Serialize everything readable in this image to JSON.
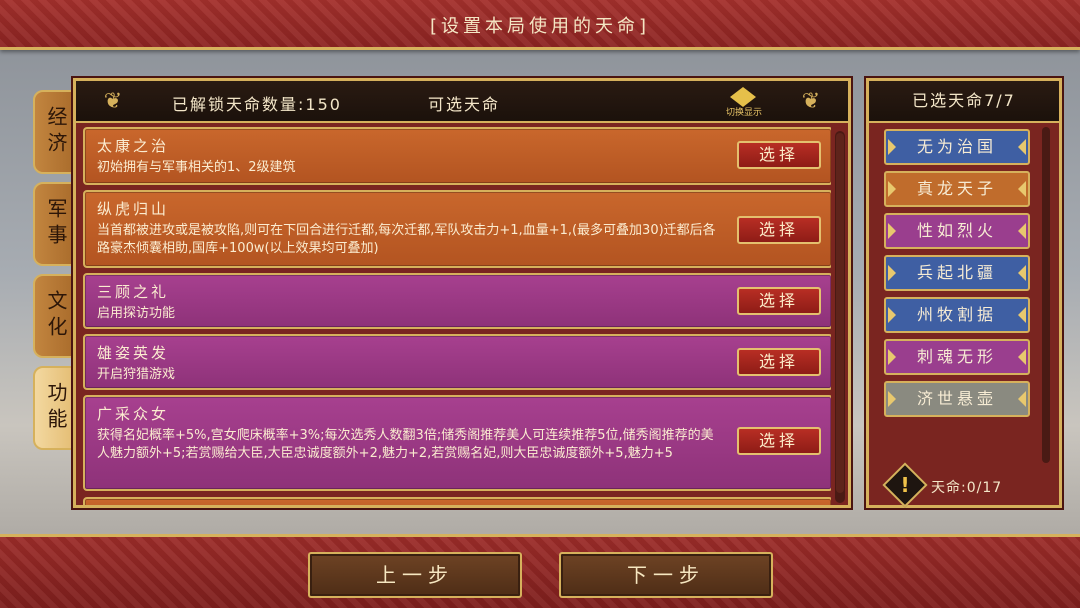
{
  "header": {
    "title": "[设置本局使用的天命]"
  },
  "tabs": [
    {
      "label": "经济",
      "active": false
    },
    {
      "label": "军事",
      "active": false
    },
    {
      "label": "文化",
      "active": false
    },
    {
      "label": "功能",
      "active": true
    }
  ],
  "main": {
    "unlock_count": "已解锁天命数量:150",
    "title": "可选天命",
    "toggle_label": "切换显示",
    "select_label": "选择",
    "cards": [
      {
        "title": "太康之治",
        "desc": "初始拥有与军事相关的1、2级建筑",
        "color": "orange"
      },
      {
        "title": "纵虎归山",
        "desc": "当首都被进攻或是被攻陷,则可在下回合进行迁都,每次迁都,军队攻击力+1,血量+1,(最多可叠加30)迁都后各路豪杰倾囊相助,国库+100w(以上效果均可叠加)",
        "color": "orange"
      },
      {
        "title": "三顾之礼",
        "desc": "启用探访功能",
        "color": "purple"
      },
      {
        "title": "雄姿英发",
        "desc": "开启狩猎游戏",
        "color": "purple"
      },
      {
        "title": "广采众女",
        "desc": "获得名妃概率+5%,宫女爬床概率+3%;每次选秀人数翻3倍;储秀阁推荐美人可连续推荐5位,储秀阁推荐的美人魅力额外+5;若赏赐给大臣,大臣忠诚度额外+2,魅力+2,若赏赐名妃,则大臣忠诚度额外+5,魅力+5",
        "color": "purple"
      }
    ]
  },
  "selected": {
    "title": "已选天命7/7",
    "items": [
      {
        "label": "无为治国",
        "color": "#3f5fa3"
      },
      {
        "label": "真龙天子",
        "color": "#c06c2c"
      },
      {
        "label": "性如烈火",
        "color": "#9a3e8e"
      },
      {
        "label": "兵起北疆",
        "color": "#3f5fa3"
      },
      {
        "label": "州牧割据",
        "color": "#3f5fa3"
      },
      {
        "label": "刺魂无形",
        "color": "#9a3e8e"
      },
      {
        "label": "济世悬壶",
        "color": "#8a8a80"
      }
    ],
    "tianming_count": "天命:0/17"
  },
  "footer": {
    "prev": "上一步",
    "next": "下一步"
  }
}
